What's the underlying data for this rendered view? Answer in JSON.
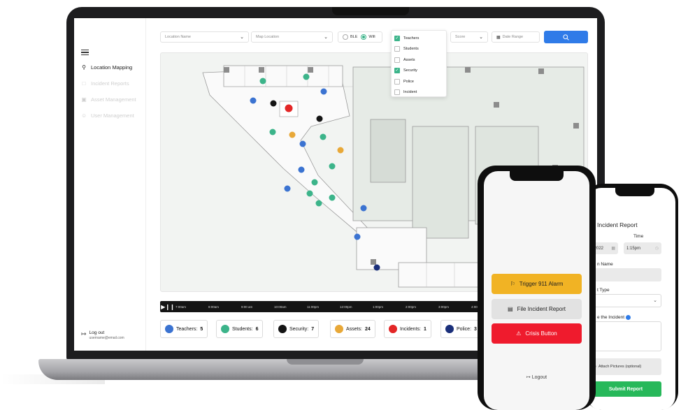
{
  "toolbar": {
    "location_name_placeholder": "Location Name",
    "map_location_placeholder": "Map Location",
    "net_ble": "BLE",
    "net_wifi": "Wifi",
    "score_placeholder": "Score",
    "date_range_placeholder": "Date Range"
  },
  "filters": [
    {
      "label": "Teachers",
      "checked": true
    },
    {
      "label": "Students",
      "checked": false
    },
    {
      "label": "Assets",
      "checked": false
    },
    {
      "label": "Security",
      "checked": true
    },
    {
      "label": "Police",
      "checked": false
    },
    {
      "label": "Incident",
      "checked": false
    }
  ],
  "sidebar": {
    "items": [
      {
        "label": "Location Mapping",
        "icon": "location-pin-icon",
        "active": true
      },
      {
        "label": "Incident Reports",
        "icon": "document-icon",
        "active": false
      },
      {
        "label": "Asset Management",
        "icon": "asset-icon",
        "active": false
      },
      {
        "label": "User Management",
        "icon": "user-icon",
        "active": false
      }
    ],
    "logout_label": "Log out",
    "user_email": "username@email.com"
  },
  "timeline": {
    "times": [
      "7:00am",
      "8:00am",
      "9:00 am",
      "10:00am",
      "11:00pm",
      "12:00pm",
      "1:00pm",
      "2:00pm",
      "3:00pm",
      "4:00pm"
    ]
  },
  "legend": [
    {
      "label": "Teachers:",
      "count": "5",
      "color": "#3b73d1"
    },
    {
      "label": "Students:",
      "count": "6",
      "color": "#3cb48a"
    },
    {
      "label": "Security:",
      "count": "7",
      "color": "#141414"
    },
    {
      "label": "Assets:",
      "count": "24",
      "color": "#e8a838"
    },
    {
      "label": "Incidents:",
      "count": "1",
      "color": "#e32626"
    },
    {
      "label": "Police:",
      "count": "3",
      "color": "#1a2f7a"
    }
  ],
  "map": {
    "markers": [
      {
        "kind": "student",
        "color": "#3cb48a"
      },
      {
        "kind": "student",
        "color": "#3cb48a"
      },
      {
        "kind": "teacher",
        "color": "#3b73d1"
      },
      {
        "kind": "teacher",
        "color": "#3b73d1"
      },
      {
        "kind": "security",
        "color": "#141414"
      },
      {
        "kind": "incident",
        "color": "#e32626"
      },
      {
        "kind": "security",
        "color": "#141414"
      },
      {
        "kind": "student",
        "color": "#3cb48a"
      },
      {
        "kind": "asset",
        "color": "#e8a838"
      },
      {
        "kind": "teacher",
        "color": "#3b73d1"
      },
      {
        "kind": "student",
        "color": "#3cb48a"
      },
      {
        "kind": "asset",
        "color": "#e8a838"
      },
      {
        "kind": "student",
        "color": "#3cb48a"
      },
      {
        "kind": "teacher",
        "color": "#3b73d1"
      },
      {
        "kind": "student",
        "color": "#3cb48a"
      },
      {
        "kind": "teacher",
        "color": "#3b73d1"
      },
      {
        "kind": "student",
        "color": "#3cb48a"
      },
      {
        "kind": "student",
        "color": "#3cb48a"
      },
      {
        "kind": "student",
        "color": "#3cb48a"
      },
      {
        "kind": "teacher",
        "color": "#3b73d1"
      },
      {
        "kind": "teacher",
        "color": "#3b73d1"
      },
      {
        "kind": "police",
        "color": "#1a2f7a"
      }
    ]
  },
  "phone1": {
    "alarm_label": "Trigger 911 Alarm",
    "report_label": "File Incident Report",
    "crisis_label": "Crisis Button",
    "logout_label": "Logout"
  },
  "phone2": {
    "title": "Incident Report",
    "time_label": "Time",
    "date_value": "/2022",
    "time_value": "1:15pm",
    "location_label": "n Name",
    "type_label": "t Type",
    "describe_label": "e the Incident",
    "attach_label": "Attach Pictures (optional)",
    "submit_label": "Submit Report"
  }
}
